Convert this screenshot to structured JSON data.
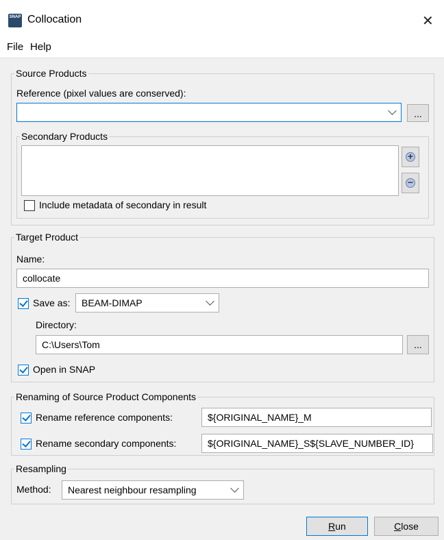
{
  "window": {
    "title": "Collocation",
    "icon_text": "SNAP"
  },
  "menu": {
    "items": [
      "File",
      "Help"
    ]
  },
  "source_products": {
    "legend": "Source Products",
    "reference_label": "Reference (pixel values are conserved):",
    "reference_value": "",
    "browse_label": "...",
    "secondary": {
      "legend": "Secondary Products",
      "add_symbol": "+",
      "remove_symbol": "−",
      "include_metadata_label": "Include metadata of secondary in result",
      "include_metadata_checked": false
    }
  },
  "target_product": {
    "legend": "Target Product",
    "name_label": "Name:",
    "name_value": "collocate",
    "save_as_label": "Save as:",
    "save_as_checked": true,
    "format_value": "BEAM-DIMAP",
    "directory_label": "Directory:",
    "directory_value": "C:\\Users\\Tom",
    "browse_label": "...",
    "open_in_snap_label": "Open in SNAP",
    "open_in_snap_checked": true
  },
  "renaming": {
    "legend": "Renaming of Source Product Components",
    "reference_label": "Rename reference components:",
    "reference_checked": true,
    "reference_pattern": "${ORIGINAL_NAME}_M",
    "secondary_label": "Rename secondary components:",
    "secondary_checked": true,
    "secondary_pattern": "${ORIGINAL_NAME}_S${SLAVE_NUMBER_ID}"
  },
  "resampling": {
    "legend": "Resampling",
    "method_label": "Method:",
    "method_value": "Nearest neighbour resampling"
  },
  "buttons": {
    "run_label_first": "R",
    "run_label_rest": "un",
    "close_label_first": "C",
    "close_label_rest": "lose"
  }
}
